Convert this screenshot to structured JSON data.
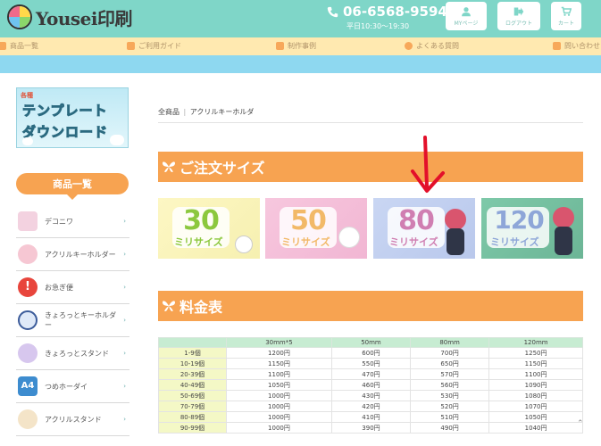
{
  "header": {
    "logo_text": "Yousei印刷",
    "phone": "06-6568-9594",
    "hours": "平日10:30〜19:30",
    "buttons": [
      {
        "label": "MYページ",
        "icon": "user-icon"
      },
      {
        "label": "ログアウト",
        "icon": "logout-icon"
      },
      {
        "label": "カート",
        "icon": "cart-icon"
      }
    ]
  },
  "nav": {
    "items": [
      {
        "label": "商品一覧"
      },
      {
        "label": "ご利用ガイド"
      },
      {
        "label": "制作事例"
      },
      {
        "label": "よくある質問"
      },
      {
        "label": "問い合わせ"
      }
    ]
  },
  "sidebar": {
    "template_banner": {
      "badge": "各種",
      "line1": "テンプレート",
      "line2": "ダウンロード"
    },
    "heading": "商品一覧",
    "items": [
      {
        "label": "デコニワ"
      },
      {
        "label": "アクリルキーホルダー"
      },
      {
        "label": "お急ぎ便"
      },
      {
        "label": "きょろっとキーホルダー"
      },
      {
        "label": "きょろっとスタンド"
      },
      {
        "label": "つめホーダイ"
      },
      {
        "label": "アクリルスタンド"
      }
    ],
    "arrow": "›"
  },
  "main": {
    "breadcrumb": {
      "root": "全商品",
      "sep": "|",
      "current": "アクリルキーホルダ"
    },
    "order_size_title": "ご注文サイズ",
    "sizes": [
      {
        "num": "30",
        "unit": "ミリサイズ"
      },
      {
        "num": "50",
        "unit": "ミリサイズ"
      },
      {
        "num": "80",
        "unit": "ミリサイズ"
      },
      {
        "num": "120",
        "unit": "ミリサイズ"
      }
    ],
    "price_title": "料金表",
    "price_table": {
      "headers": [
        "",
        "30mm*5",
        "50mm",
        "80mm",
        "120mm"
      ],
      "rows": [
        [
          "1-9個",
          "1200円",
          "600円",
          "700円",
          "1250円"
        ],
        [
          "10-19個",
          "1150円",
          "550円",
          "650円",
          "1150円"
        ],
        [
          "20-39個",
          "1100円",
          "470円",
          "570円",
          "1100円"
        ],
        [
          "40-49個",
          "1050円",
          "460円",
          "560円",
          "1090円"
        ],
        [
          "50-69個",
          "1000円",
          "430円",
          "530円",
          "1080円"
        ],
        [
          "70-79個",
          "1000円",
          "420円",
          "520円",
          "1070円"
        ],
        [
          "80-89個",
          "1000円",
          "410円",
          "510円",
          "1050円"
        ],
        [
          "90-99個",
          "1000円",
          "390円",
          "490円",
          "1040円"
        ]
      ]
    }
  },
  "colors": {
    "header": "#7fd6c8",
    "nav": "#ffe9b0",
    "band": "#8ed8f0",
    "accent": "#f7a351",
    "annotation_arrow": "#e3102a"
  }
}
